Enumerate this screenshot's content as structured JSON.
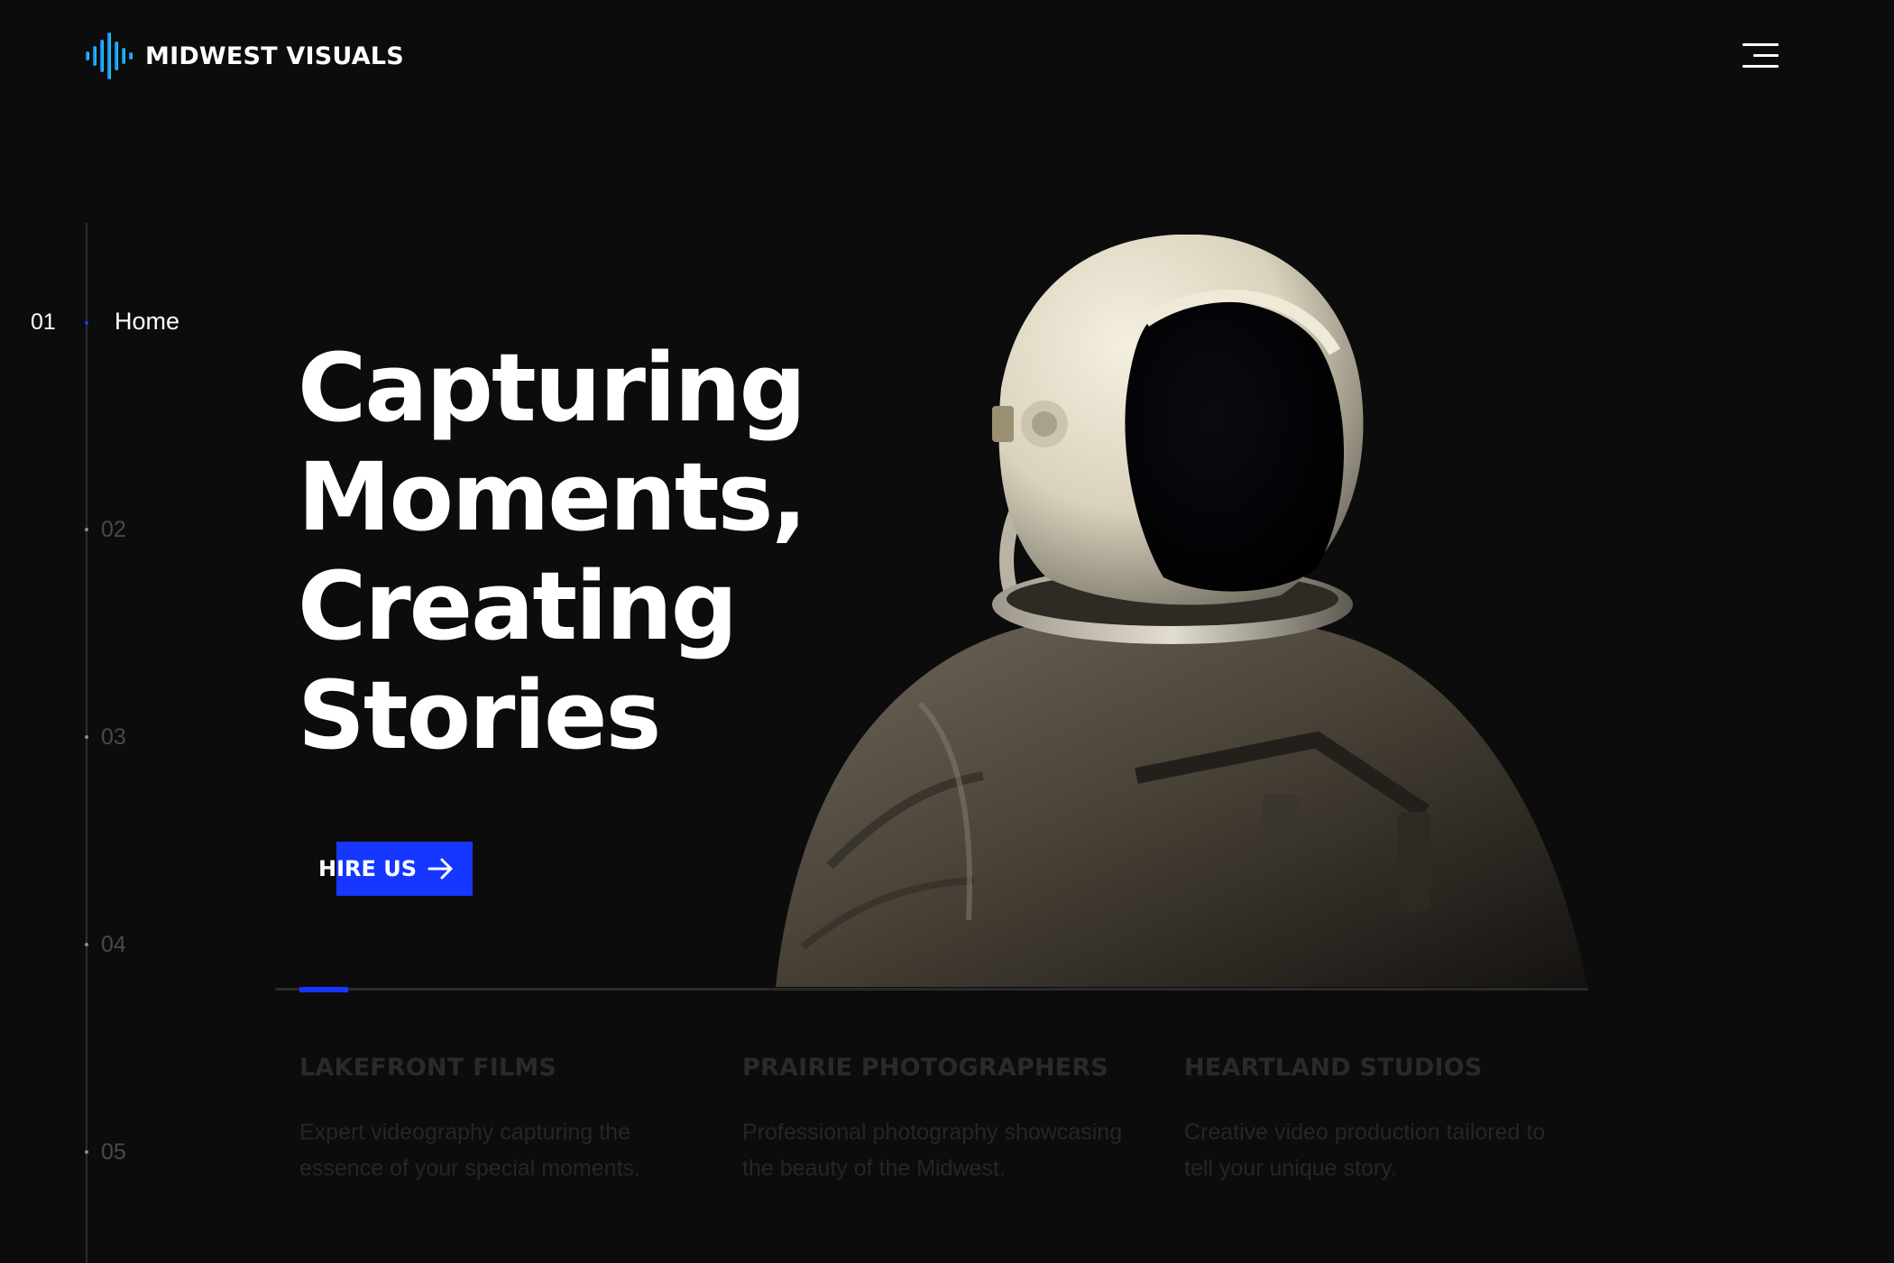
{
  "brand": {
    "name": "MIDWEST VISUALS",
    "logo_icon": "sound-wave-logo-icon",
    "logo_colors": [
      "#1a7bff",
      "#1fd0e0"
    ]
  },
  "header": {
    "menu_icon": "hamburger-menu-icon"
  },
  "side_nav": {
    "active": {
      "number": "01",
      "label": "Home"
    },
    "items": [
      {
        "number": "02"
      },
      {
        "number": "03"
      },
      {
        "number": "04"
      },
      {
        "number": "05"
      }
    ]
  },
  "hero": {
    "headline": [
      "Capturing",
      "Moments,",
      "Creating",
      "Stories"
    ],
    "cta_label": "HIRE US",
    "cta_icon": "arrow-right-icon",
    "image": "astronaut-image",
    "slide_progress_fraction": 0.037
  },
  "services": [
    {
      "title": "LAKEFRONT FILMS",
      "description": "Expert videography capturing the essence of your special moments."
    },
    {
      "title": "PRAIRIE PHOTOGRAPHERS",
      "description": "Professional photography showcasing the beauty of the Midwest."
    },
    {
      "title": "HEARTLAND STUDIOS",
      "description": "Creative video production tailored to tell your unique story."
    }
  ],
  "colors": {
    "background": "#0c0c0c",
    "accent": "#1637ff",
    "text": "#ffffff",
    "muted": "#2a2a2a"
  }
}
